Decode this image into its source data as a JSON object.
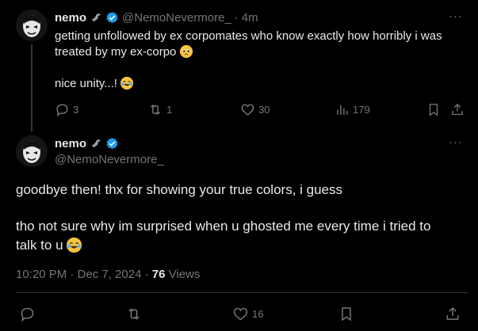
{
  "reply_tweet": {
    "name": "nemo",
    "handle": "@NemoNevermore_",
    "separator": "·",
    "time": "4m",
    "text_line1": "getting unfollowed by ex corpomates who know exactly how horribly i was",
    "text_line2": "treated by my ex-corpo",
    "text_line3": "nice unity...!",
    "actions": {
      "replies": "3",
      "reposts": "1",
      "likes": "30",
      "views": "179"
    }
  },
  "main_tweet": {
    "name": "nemo",
    "handle": "@NemoNevermore_",
    "paragraph1": "goodbye then! thx for showing your true colors, i guess",
    "paragraph2_line1": "tho not sure why im surprised when u ghosted me every time i tried to",
    "paragraph2_line2": "talk to u",
    "timestamp": "10:20 PM · Dec 7, 2024 ·",
    "views_count": "76",
    "views_label": "Views",
    "actions": {
      "likes": "16"
    }
  },
  "more_label": "···",
  "icons": {
    "crow": "crow-icon",
    "verified": "verified-badge-icon",
    "reply": "reply-icon",
    "repost": "repost-icon",
    "like": "heart-icon",
    "views": "views-icon",
    "bookmark": "bookmark-icon",
    "share": "share-icon",
    "emoji_woozy": "pleading-face-emoji",
    "emoji_laugh": "laughing-tears-emoji"
  },
  "colors": {
    "background": "#000000",
    "text": "#e7e9ea",
    "muted": "#71767b",
    "verified": "#1d9bf0",
    "divider": "#2f3336"
  }
}
